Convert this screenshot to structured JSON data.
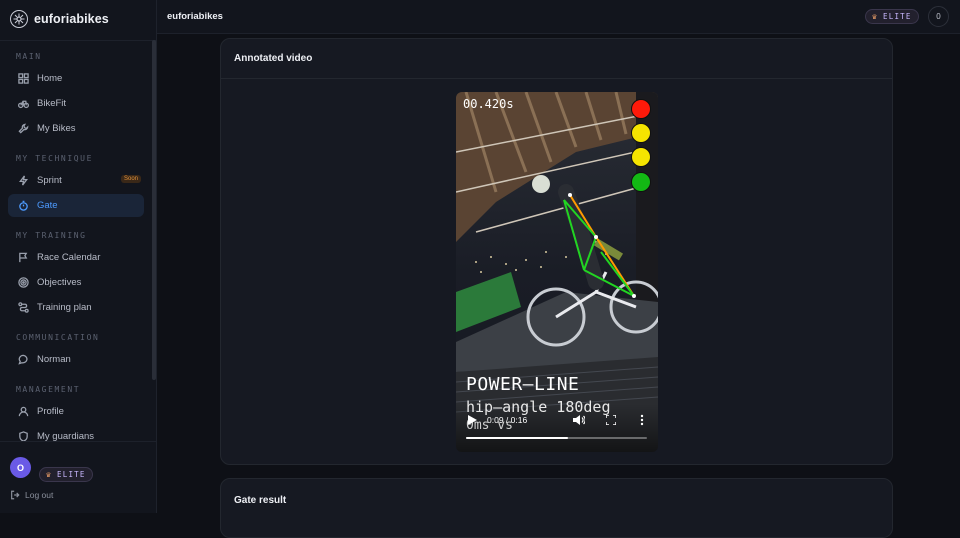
{
  "brand": {
    "name": "euforiabikes"
  },
  "sidebar": {
    "sections": [
      {
        "label": "MAIN"
      },
      {
        "label": "MY TECHNIQUE"
      },
      {
        "label": "MY TRAINING"
      },
      {
        "label": "COMMUNICATION"
      },
      {
        "label": "MANAGEMENT"
      }
    ],
    "items": [
      {
        "label": "Home",
        "icon": "grid-icon"
      },
      {
        "label": "BikeFit",
        "icon": "bike-icon"
      },
      {
        "label": "My Bikes",
        "icon": "wrench-icon"
      },
      {
        "label": "Sprint",
        "icon": "bolt-icon",
        "badge": "Soon"
      },
      {
        "label": "Gate",
        "icon": "stopwatch-icon",
        "active": true
      },
      {
        "label": "Race Calendar",
        "icon": "flag-icon"
      },
      {
        "label": "Objectives",
        "icon": "target-icon"
      },
      {
        "label": "Training plan",
        "icon": "route-icon"
      },
      {
        "label": "Norman",
        "icon": "chat-icon"
      },
      {
        "label": "Profile",
        "icon": "user-icon"
      },
      {
        "label": "My guardians",
        "icon": "shield-icon"
      }
    ],
    "footer": {
      "avatar_initial": "O",
      "elite_label": "ELITE",
      "logout_label": "Log out"
    }
  },
  "topbar": {
    "title": "euforiabikes",
    "elite_label": "ELITE",
    "count": "0"
  },
  "cards": {
    "annotated_title": "Annotated video",
    "result_title": "Gate result"
  },
  "video": {
    "overlay_time": "00.420s",
    "overlay_title": "POWER—LINE",
    "overlay_sub": "hip—angle 180deg",
    "overlay_sub2": "0ms vs",
    "current_time": "0:09 / 0:16",
    "progress": 0.5625,
    "lights": [
      "#ff1a0a",
      "#f5e400",
      "#f5e400",
      "#13b814"
    ]
  },
  "colors": {
    "accent": "#4d9bff",
    "elite": "#c9b8ff"
  }
}
